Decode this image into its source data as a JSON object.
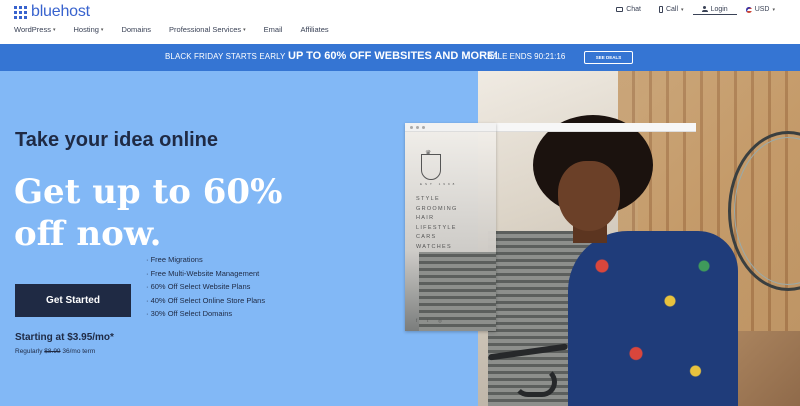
{
  "brand": {
    "name": "bluehost",
    "color": "#3863ce"
  },
  "utility_nav": {
    "chat": "Chat",
    "call": "Call",
    "login": "Login",
    "currency": "USD"
  },
  "main_nav": [
    {
      "label": "WordPress",
      "has_caret": true
    },
    {
      "label": "Hosting",
      "has_caret": true
    },
    {
      "label": "Domains",
      "has_caret": false
    },
    {
      "label": "Professional Services",
      "has_caret": true
    },
    {
      "label": "Email",
      "has_caret": false
    },
    {
      "label": "Affiliates",
      "has_caret": false
    }
  ],
  "promo": {
    "early": "BLACK FRIDAY STARTS EARLY",
    "main": "UP TO 60% OFF WEBSITES AND MORE!",
    "ends": "SALE ENDS 90:21:16",
    "button": "SEE DEALS",
    "bg_color": "#3575d3"
  },
  "hero": {
    "tagline": "Take your idea online",
    "headline": "Get up to 60% off now.",
    "cta": "Get Started",
    "price": "Starting at $3.95/mo*",
    "regular_label": "Regularly",
    "regular_price": "$8.99",
    "term": "36/mo term",
    "bg_color": "#82b8f6",
    "features": [
      "Free Migrations",
      "Free Multi-Website Management",
      "60% Off Select Website Plans",
      "40% Off Select Online Store Plans",
      "30% Off Select Domains"
    ]
  },
  "mock_site": {
    "crest_left": "EST",
    "crest_right": "1998",
    "menu": [
      "STYLE",
      "GROOMING",
      "HAIR",
      "LIFESTYLE",
      "CARS",
      "WATCHES"
    ],
    "social": [
      "f",
      "t",
      "◎"
    ]
  }
}
